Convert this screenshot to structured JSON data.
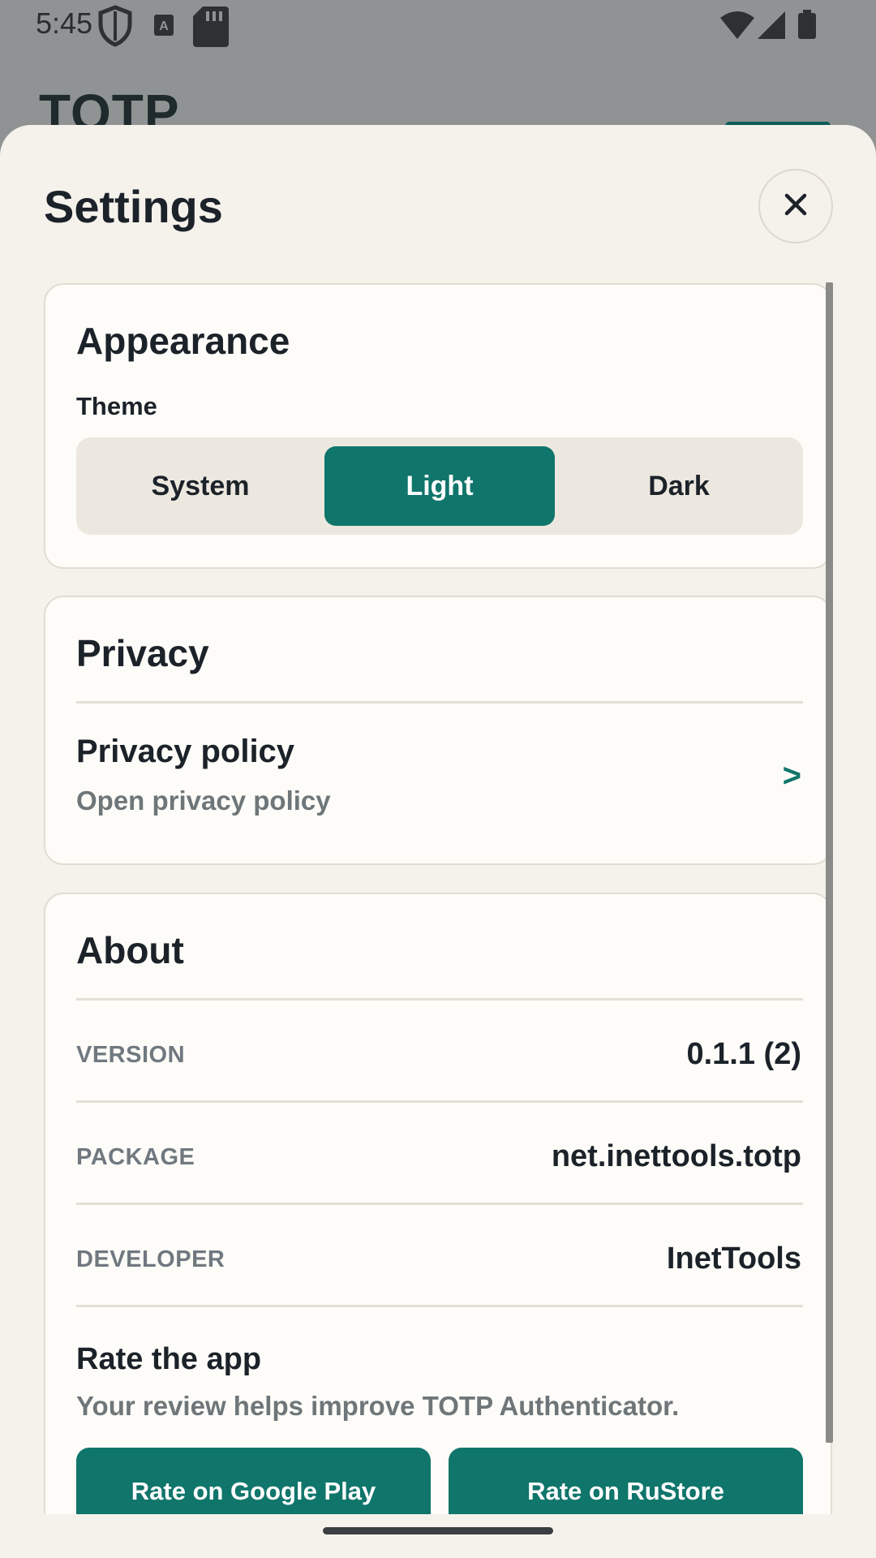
{
  "status_bar": {
    "time": "5:45"
  },
  "background": {
    "title": "TOTP"
  },
  "sheet": {
    "title": "Settings",
    "appearance": {
      "title": "Appearance",
      "theme_label": "Theme",
      "options": [
        "System",
        "Light",
        "Dark"
      ],
      "selected": "Light"
    },
    "privacy": {
      "title": "Privacy",
      "policy_title": "Privacy policy",
      "policy_sub": "Open privacy policy",
      "chevron": ">"
    },
    "about": {
      "title": "About",
      "version_label": "VERSION",
      "version_value": "0.1.1 (2)",
      "package_label": "PACKAGE",
      "package_value": "net.inettools.totp",
      "developer_label": "DEVELOPER",
      "developer_value": "InetTools",
      "rate_title": "Rate the app",
      "rate_sub": "Your review helps improve TOTP Authenticator.",
      "rate_google": "Rate on Google Play",
      "rate_rustore": "Rate on RuStore"
    }
  },
  "colors": {
    "accent": "#10756b",
    "sheet_bg": "#f5f2ec",
    "card_bg": "#fdfcf8"
  }
}
